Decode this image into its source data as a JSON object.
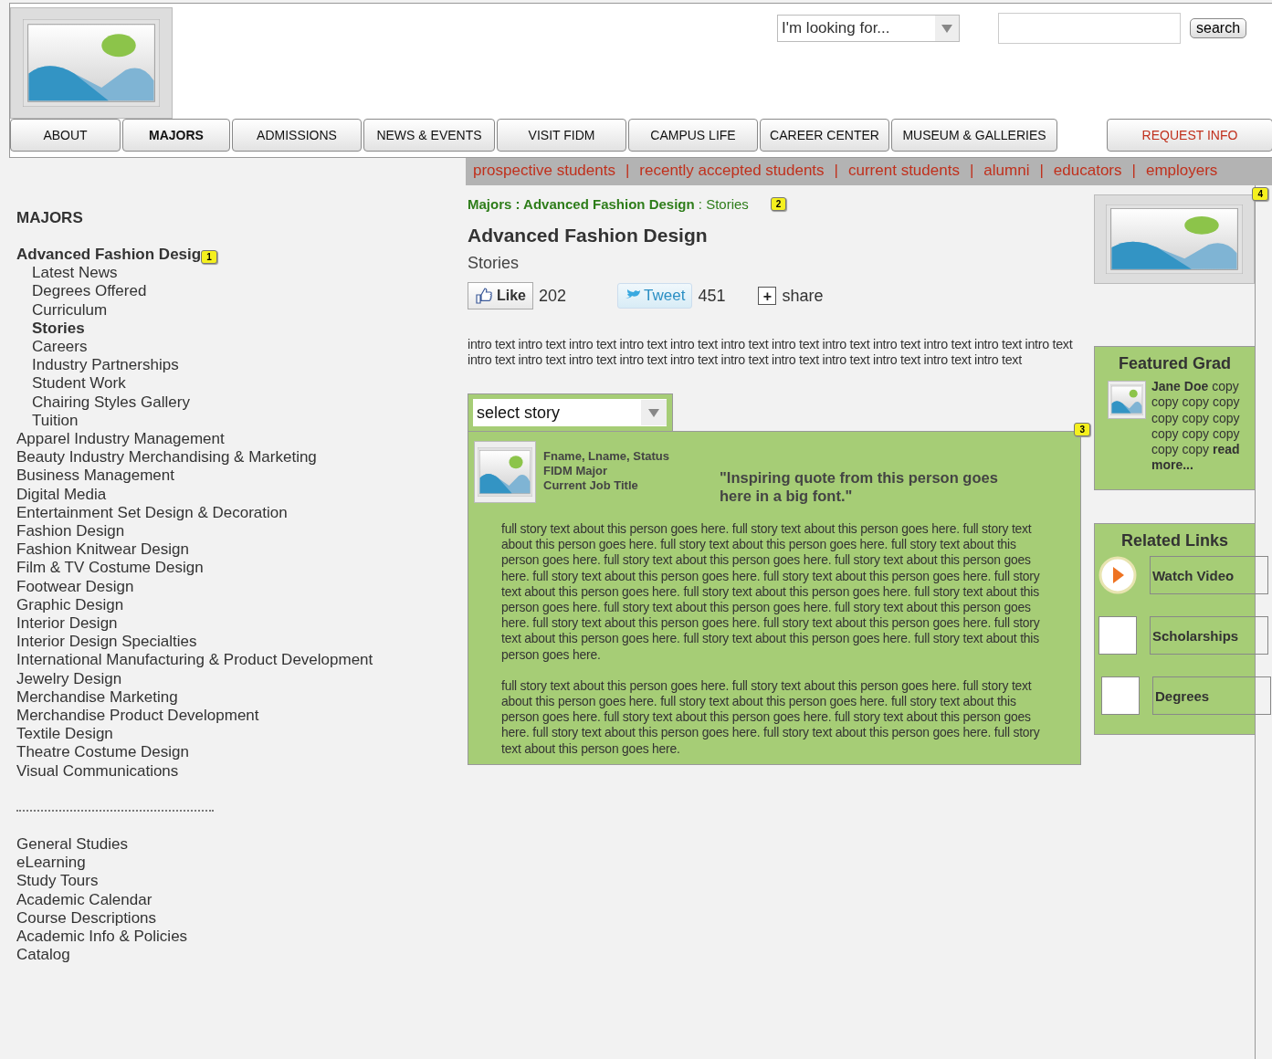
{
  "search": {
    "dropdown": "I'm looking for...",
    "button": "search"
  },
  "nav_tabs": [
    {
      "label": "ABOUT",
      "selected": false
    },
    {
      "label": "MAJORS",
      "selected": true
    },
    {
      "label": "ADMISSIONS",
      "selected": false
    },
    {
      "label": "NEWS & EVENTS",
      "selected": false
    },
    {
      "label": "VISIT FIDM",
      "selected": false
    },
    {
      "label": "CAMPUS LIFE",
      "selected": false
    },
    {
      "label": "CAREER CENTER",
      "selected": false
    },
    {
      "label": "MUSEUM & GALLERIES",
      "selected": false
    }
  ],
  "request_info": "REQUEST INFO",
  "audience_links": [
    "prospective students",
    "recently accepted students",
    "current students",
    "alumni",
    "educators",
    "employers"
  ],
  "audience_separator": "|",
  "sidebar": {
    "title": "MAJORS",
    "badge": "1",
    "items": [
      {
        "label": "Advanced Fashion Desig",
        "selected": true,
        "children": [
          {
            "label": "Latest News",
            "selected": false
          },
          {
            "label": "Degrees Offered",
            "selected": false
          },
          {
            "label": "Curriculum",
            "selected": false
          },
          {
            "label": "Stories",
            "selected": true
          },
          {
            "label": "Careers",
            "selected": false
          },
          {
            "label": "Industry Partnerships",
            "selected": false
          },
          {
            "label": "Student Work",
            "selected": false
          },
          {
            "label": "Chairing Styles Gallery",
            "selected": false
          },
          {
            "label": "Tuition",
            "selected": false
          }
        ]
      },
      {
        "label": "Apparel Industry Management",
        "selected": false
      },
      {
        "label": "Beauty Industry Merchandising & Marketing",
        "selected": false
      },
      {
        "label": "Business Management",
        "selected": false
      },
      {
        "label": "Digital Media",
        "selected": false
      },
      {
        "label": "Entertainment Set Design & Decoration",
        "selected": false
      },
      {
        "label": "Fashion Design",
        "selected": false
      },
      {
        "label": "Fashion Knitwear Design",
        "selected": false
      },
      {
        "label": "Film & TV Costume Design",
        "selected": false
      },
      {
        "label": "Footwear Design",
        "selected": false
      },
      {
        "label": "Graphic Design",
        "selected": false
      },
      {
        "label": "Interior Design",
        "selected": false
      },
      {
        "label": "Interior Design Specialties",
        "selected": false
      },
      {
        "label": "International Manufacturing & Product Development",
        "selected": false
      },
      {
        "label": "Jewelry Design",
        "selected": false
      },
      {
        "label": "Merchandise Marketing",
        "selected": false
      },
      {
        "label": "Merchandise Product Development",
        "selected": false
      },
      {
        "label": "Textile Design",
        "selected": false
      },
      {
        "label": "Theatre Costume Design",
        "selected": false
      },
      {
        "label": "Visual Communications",
        "selected": false
      }
    ],
    "secondary_items": [
      "General Studies",
      "eLearning",
      "Study Tours",
      "Academic Calendar",
      "Course Descriptions",
      "Academic Info & Policies",
      "Catalog"
    ]
  },
  "breadcrumb": "**Majors : Advanced Fashion Design** : Stories",
  "breadcrumb_badge": "2",
  "heading": "Advanced Fashion Design",
  "subheading": "Stories",
  "social": {
    "like": "Like",
    "like_count": "202",
    "tweet": "Tweet",
    "tweet_count": "451",
    "share_icon": "+",
    "share": "share"
  },
  "intro": "intro text intro text intro text intro text intro text intro text intro text intro text intro text intro text intro text intro text intro text intro text intro text intro text intro text intro text intro text intro text intro text intro text intro text",
  "story_select": "select story",
  "story_badge": "3",
  "story": {
    "name_line": "Fname, Lname, Status",
    "major": "FIDM Major",
    "job": "Current Job Title",
    "quote": "\"Inspiring quote from this person goes here in a big font.\"",
    "paragraphs": [
      "full story text about this person goes here.  full story text about this person goes here. full story text about this person goes here.  full story text about this person goes here. full story text about this person goes here.  full story text about this person goes here. full story text about this person goes here.  full story text about this person goes here. full story text about this person goes here.  full story text about this person goes here. full story text about this person goes here.  full story text about this person goes here. full story text about this person goes here.  full story text about this person goes here. full story text about this person goes here.  full story text about this person goes here. full story text about this person goes here.  full story text about this person goes here. full story text about this person goes here.",
      "full story text about this person goes here.  full story text about this person goes here. full story text about this person goes here.  full story text about this person goes here. full story text about this person goes here.  full story text about this person goes here. full story text about this person goes here.  full story text about this person goes here. full story text about this person goes here.  full story text about this person goes here."
    ]
  },
  "right_badge": "4",
  "featured": {
    "title": "Featured Grad",
    "text": "**Jane Doe** copy copy copy copy copy copy copy copy copy copy copy copy **read more...**"
  },
  "related": {
    "title": "Related Links",
    "links": [
      {
        "label": "Watch Video",
        "kind": "video"
      },
      {
        "label": "Scholarships",
        "kind": "blank"
      },
      {
        "label": "Degrees",
        "kind": "blank"
      }
    ]
  }
}
